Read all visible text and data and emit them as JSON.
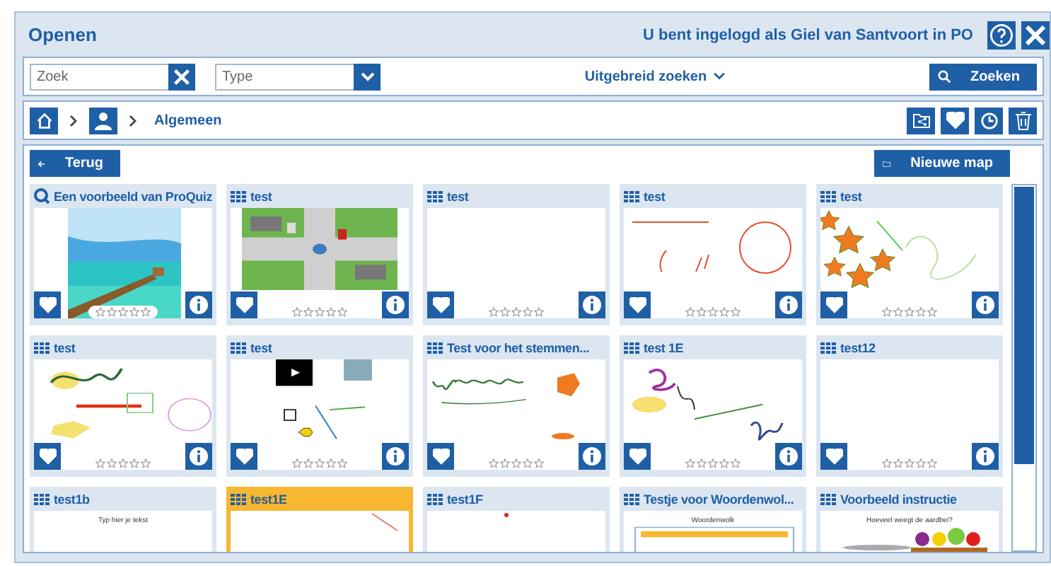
{
  "window": {
    "title": "Openen",
    "login_text": "U bent ingelogd als Giel van Santvoort in PO"
  },
  "search": {
    "placeholder": "Zoek",
    "type_placeholder": "Type",
    "advanced": "Uitgebreid zoeken",
    "button": "Zoeken"
  },
  "breadcrumb": {
    "current": "Algemeen"
  },
  "toolbar": {
    "back": "Terug",
    "new_folder": "Nieuwe map"
  },
  "cards": [
    {
      "title": "Een voorbeeld van ProQuiz",
      "kind": "proquiz",
      "stars": 0,
      "selected": false
    },
    {
      "title": "test",
      "kind": "lesson",
      "thumbnail": {
        "kind": "roads"
      },
      "stars": 0,
      "selected": false
    },
    {
      "title": "test",
      "kind": "lesson",
      "thumbnail": {
        "kind": "blank"
      },
      "stars": 0,
      "selected": false
    },
    {
      "title": "test",
      "kind": "lesson",
      "thumbnail": {
        "kind": "lines"
      },
      "stars": 0,
      "selected": false
    },
    {
      "title": "test",
      "kind": "lesson",
      "thumbnail": {
        "kind": "starshapes"
      },
      "stars": 0,
      "selected": false
    },
    {
      "title": "test",
      "kind": "lesson",
      "thumbnail": {
        "kind": "cursive"
      },
      "stars": 0,
      "selected": false
    },
    {
      "title": "test",
      "kind": "lesson",
      "thumbnail": {
        "kind": "media"
      },
      "stars": 0,
      "selected": false
    },
    {
      "title": "Test  voor het stemmen...",
      "kind": "lesson",
      "thumbnail": {
        "kind": "welkom"
      },
      "stars": 0,
      "selected": false
    },
    {
      "title": "test 1E",
      "kind": "lesson",
      "thumbnail": {
        "kind": "scribble"
      },
      "stars": 0,
      "selected": false
    },
    {
      "title": "test12",
      "kind": "lesson",
      "thumbnail": {
        "kind": "blank"
      },
      "stars": 0,
      "selected": false
    },
    {
      "title": "test1b",
      "kind": "lesson",
      "thumbnail": {
        "kind": "blank",
        "caption": "Typ hier je tekst"
      },
      "selected": false
    },
    {
      "title": "test1E",
      "kind": "lesson",
      "thumbnail": {
        "kind": "line"
      },
      "selected": true
    },
    {
      "title": "test1F",
      "kind": "lesson",
      "thumbnail": {
        "kind": "dot"
      },
      "selected": false
    },
    {
      "title": "Testje voor Woordenwol...",
      "kind": "lesson",
      "thumbnail": {
        "kind": "cloud",
        "caption": "Woordenwolk"
      },
      "selected": false
    },
    {
      "title": "Voorbeeld instructie",
      "kind": "lesson",
      "thumbnail": {
        "kind": "fruit",
        "caption": "Hoeveel weegt de aardbei?"
      },
      "selected": false
    }
  ]
}
